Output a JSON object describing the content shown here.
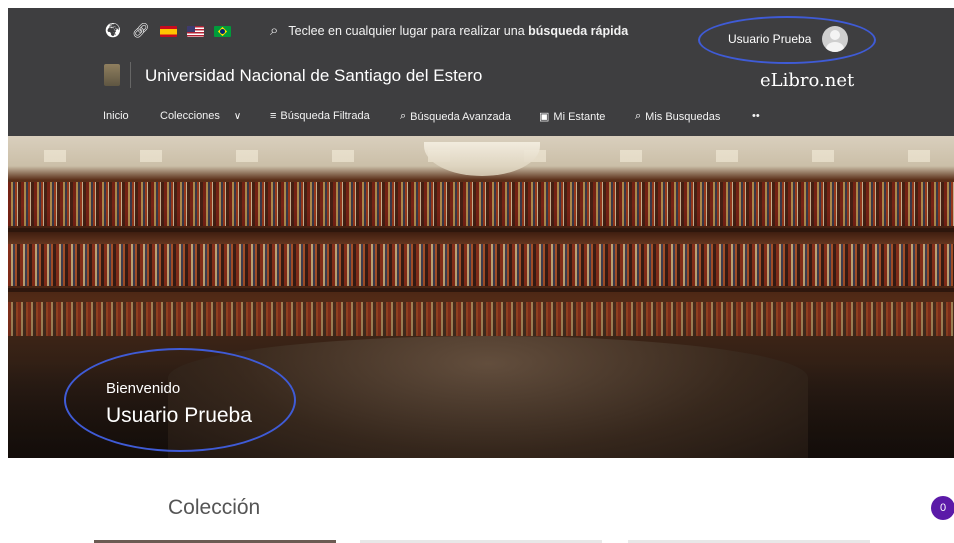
{
  "header": {
    "search_hint_prefix": "Teclee en cualquier lugar para realizar una ",
    "search_hint_bold": "búsqueda rápida",
    "user_name": "Usuario Prueba",
    "university_name": "Universidad Nacional de Santiago del Estero",
    "brand_logo_text": "eLibro.net"
  },
  "icons": {
    "globe": "globe-icon",
    "link": "link-icon",
    "flags": [
      "flag-es-icon",
      "flag-us-icon",
      "flag-br-icon"
    ],
    "search": "search-icon"
  },
  "nav": {
    "items": [
      {
        "label": "Inicio",
        "icon": ""
      },
      {
        "label": "Colecciones",
        "icon": "chevron-down-icon"
      },
      {
        "label": "Búsqueda Filtrada",
        "icon": "filter-sliders-icon"
      },
      {
        "label": "Búsqueda Avanzada",
        "icon": "search-icon"
      },
      {
        "label": "Mi Estante",
        "icon": "briefcase-icon"
      },
      {
        "label": "Mis Busquedas",
        "icon": "search-icon"
      },
      {
        "label": "••",
        "icon": "more-icon"
      }
    ]
  },
  "hero": {
    "welcome_small": "Bienvenido",
    "welcome_name": "Usuario Prueba"
  },
  "main": {
    "section_title": "Colección",
    "notification_count": "0"
  },
  "colors": {
    "header_bg": "#3e3e40",
    "annotation_ellipse": "#3f5bd6",
    "badge": "#5b1aa8"
  }
}
